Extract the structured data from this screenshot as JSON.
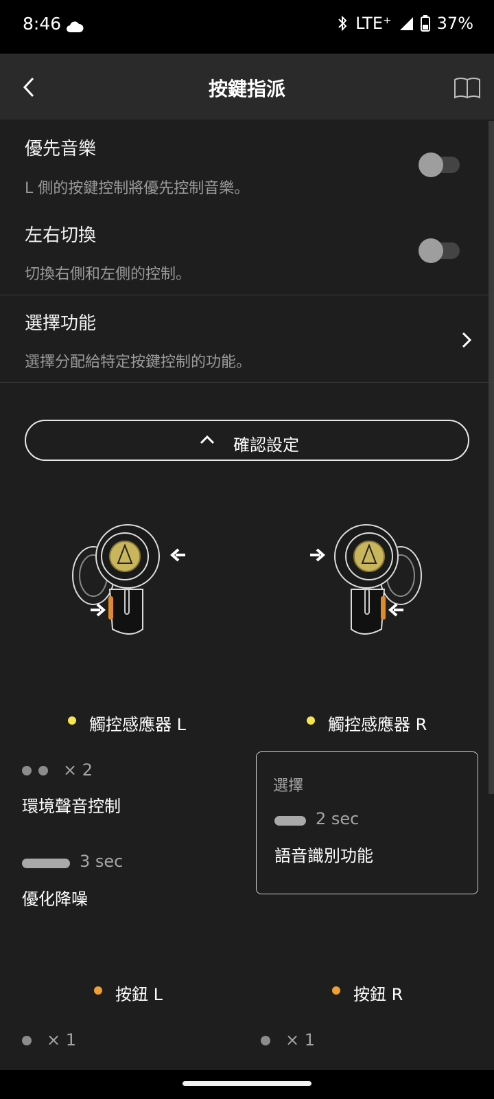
{
  "status_bar": {
    "time": "8:46",
    "network": "LTE⁺",
    "battery": "37%"
  },
  "app_bar": {
    "title": "按鍵指派"
  },
  "settings": [
    {
      "title": "優先音樂",
      "subtitle": "L 側的按鍵控制將優先控制音樂。",
      "enabled": false
    },
    {
      "title": "左右切換",
      "subtitle": "切換右側和左側的控制。",
      "enabled": false
    }
  ],
  "select_function": {
    "title": "選擇功能",
    "subtitle": "選擇分配給特定按鍵控制的功能。"
  },
  "confirm_button": {
    "label": "確認設定"
  },
  "touch_sensors": {
    "left": {
      "label": "觸控感應器 L",
      "actions": [
        {
          "gesture": "× 2",
          "function": "環境聲音控制"
        },
        {
          "gesture": "3 sec",
          "function": "優化降噪"
        }
      ]
    },
    "right": {
      "label": "觸控感應器 R",
      "box_label": "選擇",
      "actions": [
        {
          "gesture": "2 sec",
          "function": "語音識別功能"
        }
      ]
    }
  },
  "buttons": {
    "left": {
      "label": "按鈕 L",
      "gesture": "× 1"
    },
    "right": {
      "label": "按鈕 R",
      "gesture": "× 1"
    }
  },
  "colors": {
    "sensor_dot": "#f5e64a",
    "button_dot": "#f0a030",
    "background": "#1e1e1e"
  }
}
